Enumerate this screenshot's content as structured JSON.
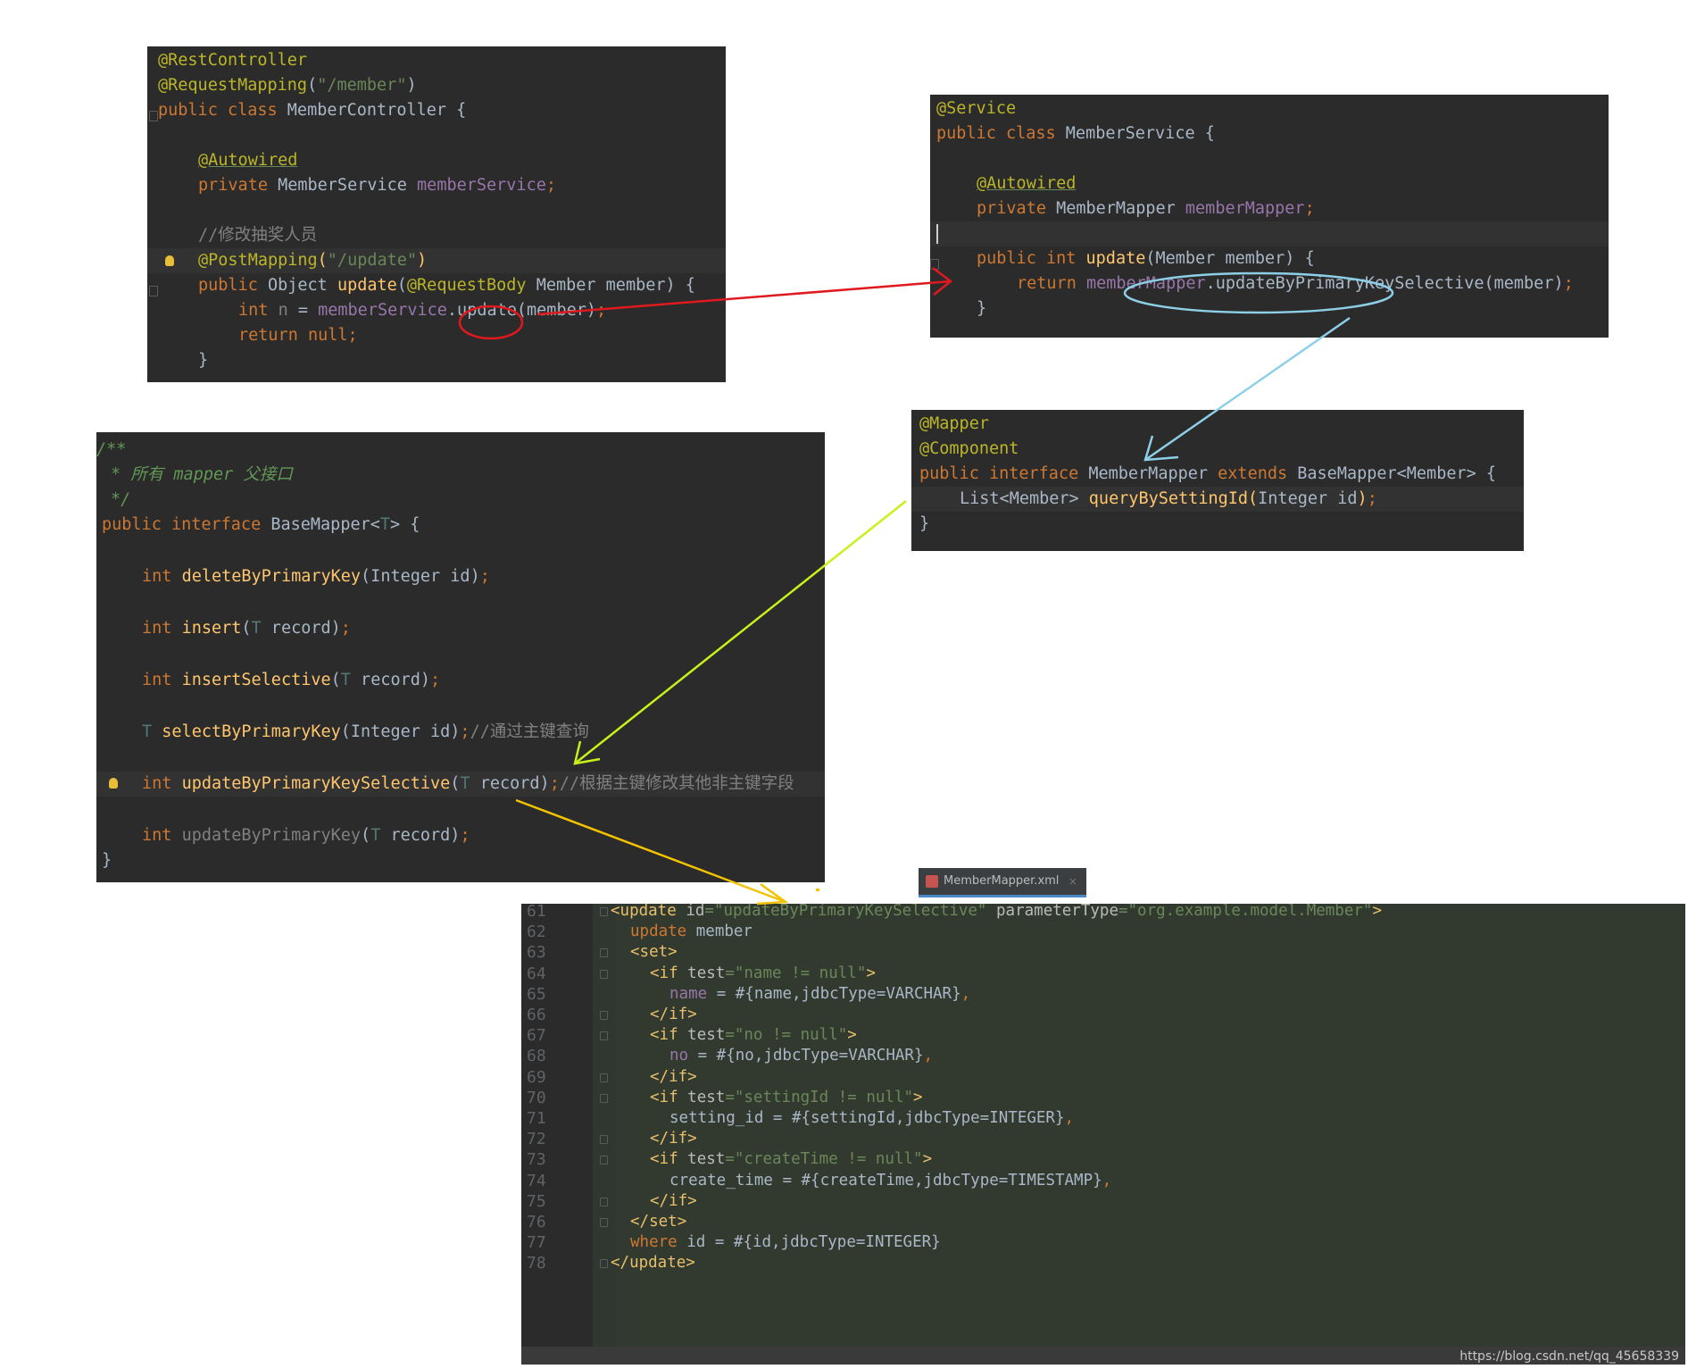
{
  "controller": {
    "lines": [
      "@RestController",
      "@RequestMapping(\"/member\")",
      "public class MemberController {",
      "",
      "@Autowired",
      "private MemberService memberService;",
      "",
      "//修改抽奖人员",
      "@PostMapping(\"/update\")",
      "public Object update(@RequestBody Member member) {",
      "int n = memberService.update(member);",
      "return null;",
      "}"
    ]
  },
  "service": {
    "lines": [
      "@Service",
      "public class MemberService {",
      "",
      "@Autowired",
      "private MemberMapper memberMapper;",
      "",
      "public int update(Member member) {",
      "return memberMapper.updateByPrimaryKeySelective(member);",
      "}"
    ]
  },
  "mapper": {
    "lines": [
      "@Mapper",
      "@Component",
      "public interface MemberMapper extends BaseMapper<Member> {",
      "List<Member> queryBySettingId(Integer id);",
      "}"
    ]
  },
  "base": {
    "lines": [
      "/**",
      "* 所有 mapper 父接口",
      "*/",
      "public interface BaseMapper<T> {",
      "int deleteByPrimaryKey(Integer id);",
      "int insert(T record);",
      "int insertSelective(T record);",
      "T selectByPrimaryKey(Integer id);//通过主键查询",
      "int updateByPrimaryKeySelective(T record);//根据主键修改其他非主键字段",
      "int updateByPrimaryKey(T record);",
      "}"
    ]
  },
  "xml_tab": {
    "label": "MemberMapper.xml",
    "close": "×"
  },
  "xml": {
    "line_numbers": [
      "61",
      "62",
      "63",
      "64",
      "65",
      "66",
      "67",
      "68",
      "69",
      "70",
      "71",
      "72",
      "73",
      "74",
      "75",
      "76",
      "77",
      "78"
    ],
    "lines": [
      "<update id=\"updateByPrimaryKeySelective\" parameterType=\"org.example.model.Member\">",
      "update member",
      "<set>",
      "<if test=\"name != null\">",
      "name = #{name,jdbcType=VARCHAR},",
      "</if>",
      "<if test=\"no != null\">",
      "no = #{no,jdbcType=VARCHAR},",
      "</if>",
      "<if test=\"settingId != null\">",
      "setting_id = #{settingId,jdbcType=INTEGER},",
      "</if>",
      "<if test=\"createTime != null\">",
      "create_time = #{createTime,jdbcType=TIMESTAMP},",
      "</if>",
      "</set>",
      "where id = #{id,jdbcType=INTEGER}",
      "</update>"
    ]
  },
  "watermark": "https://blog.csdn.net/qq_45658339",
  "colors": {
    "arrow_red": "#e0191f",
    "arrow_blue": "#8ecfe8",
    "arrow_green": "#c6f21b",
    "arrow_yellow": "#f3c200",
    "editor_bg": "#2b2b2b",
    "xml_bg": "#323a30"
  }
}
